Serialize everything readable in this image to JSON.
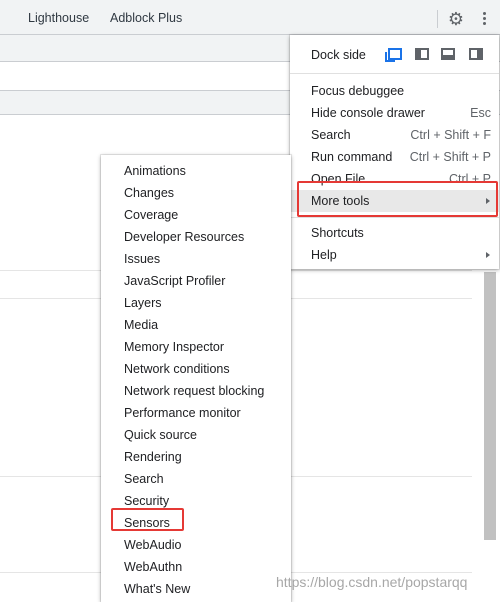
{
  "toolbar": {
    "tabs": [
      "Lighthouse",
      "Adblock Plus"
    ],
    "settings_icon": "gear-icon",
    "more_icon": "kebab-menu-icon"
  },
  "main_menu": {
    "dock_side_label": "Dock side",
    "dock_options": [
      "undock-icon",
      "dock-left-icon",
      "dock-bottom-icon",
      "dock-right-icon"
    ],
    "items": [
      {
        "label": "Focus debuggee",
        "shortcut": ""
      },
      {
        "label": "Hide console drawer",
        "shortcut": "Esc"
      },
      {
        "label": "Search",
        "shortcut": "Ctrl + Shift + F"
      },
      {
        "label": "Run command",
        "shortcut": "Ctrl + Shift + P"
      },
      {
        "label": "Open File",
        "shortcut": "Ctrl + P"
      },
      {
        "label": "More tools",
        "shortcut": "",
        "submenu": true,
        "highlighted": true
      },
      {
        "label": "Shortcuts",
        "shortcut": ""
      },
      {
        "label": "Help",
        "shortcut": "",
        "submenu": true
      }
    ]
  },
  "more_tools_menu": {
    "items": [
      "Animations",
      "Changes",
      "Coverage",
      "Developer Resources",
      "Issues",
      "JavaScript Profiler",
      "Layers",
      "Media",
      "Memory Inspector",
      "Network conditions",
      "Network request blocking",
      "Performance monitor",
      "Quick source",
      "Rendering",
      "Search",
      "Security",
      "Sensors",
      "WebAudio",
      "WebAuthn",
      "What's New"
    ]
  },
  "annotations": {
    "highlight_color": "#e53935",
    "highlighted_items": [
      "More tools",
      "Sensors"
    ]
  },
  "watermark": "https://blog.csdn.net/popstarqq"
}
